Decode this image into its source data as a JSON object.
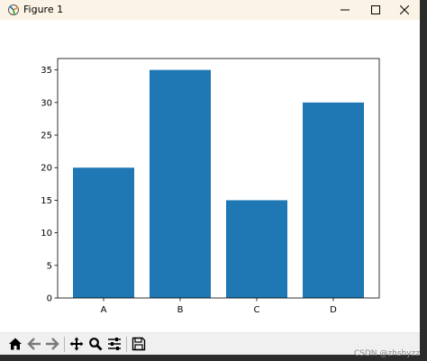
{
  "window": {
    "title": "Figure 1"
  },
  "chart_data": {
    "type": "bar",
    "categories": [
      "A",
      "B",
      "C",
      "D"
    ],
    "values": [
      20,
      35,
      15,
      30
    ],
    "title": "",
    "xlabel": "",
    "ylabel": "",
    "ylim": [
      0,
      36.75
    ],
    "yticks": [
      0,
      5,
      10,
      15,
      20,
      25,
      30,
      35
    ],
    "grid": false,
    "bar_color": "#1f77b4"
  },
  "toolbar": {
    "buttons": [
      "home-icon",
      "back-icon",
      "forward-icon",
      "pan-icon",
      "zoom-icon",
      "configure-subplots-icon",
      "save-icon"
    ]
  },
  "watermark": "CSDN @zhshyzz"
}
